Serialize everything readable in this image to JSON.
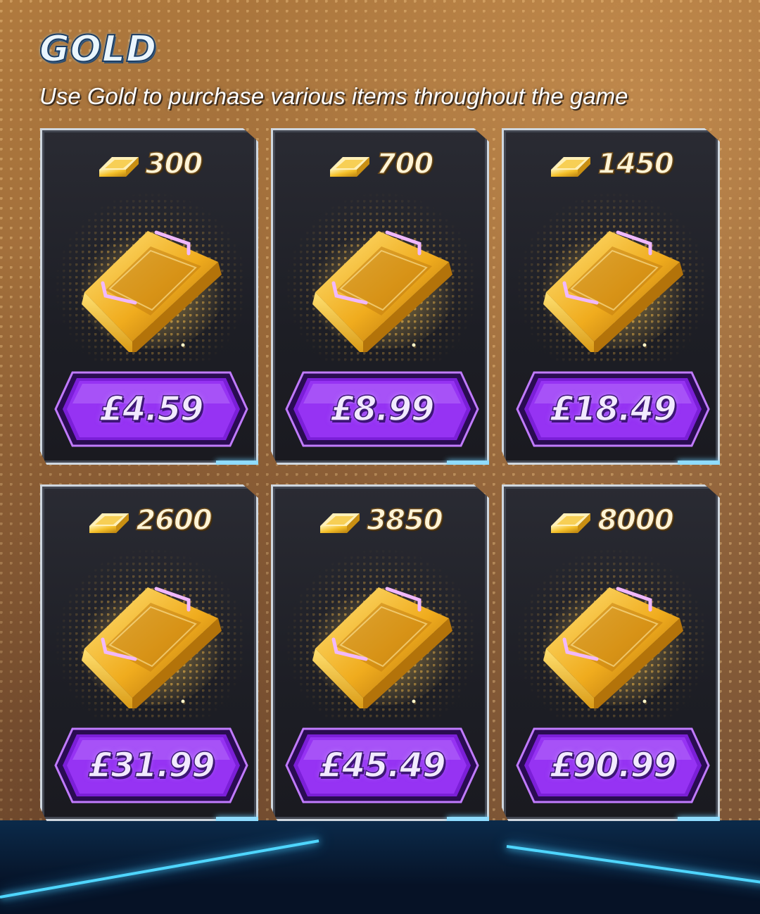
{
  "header": {
    "title": "GOLD",
    "subtitle": "Use Gold to purchase various items throughout the game"
  },
  "offers": [
    {
      "amount": "300",
      "price": "£4.59"
    },
    {
      "amount": "700",
      "price": "£8.99"
    },
    {
      "amount": "1450",
      "price": "£18.49"
    },
    {
      "amount": "2600",
      "price": "£31.99"
    },
    {
      "amount": "3850",
      "price": "£45.49"
    },
    {
      "amount": "8000",
      "price": "£90.99"
    }
  ],
  "icons": {
    "gold": "gold-bar-icon"
  },
  "colors": {
    "panel": "#9b6a3a",
    "card": "#1d1e25",
    "button": "#8a2be2",
    "accent_glow": "#4fd6ff",
    "gold": "#f5c02a"
  }
}
